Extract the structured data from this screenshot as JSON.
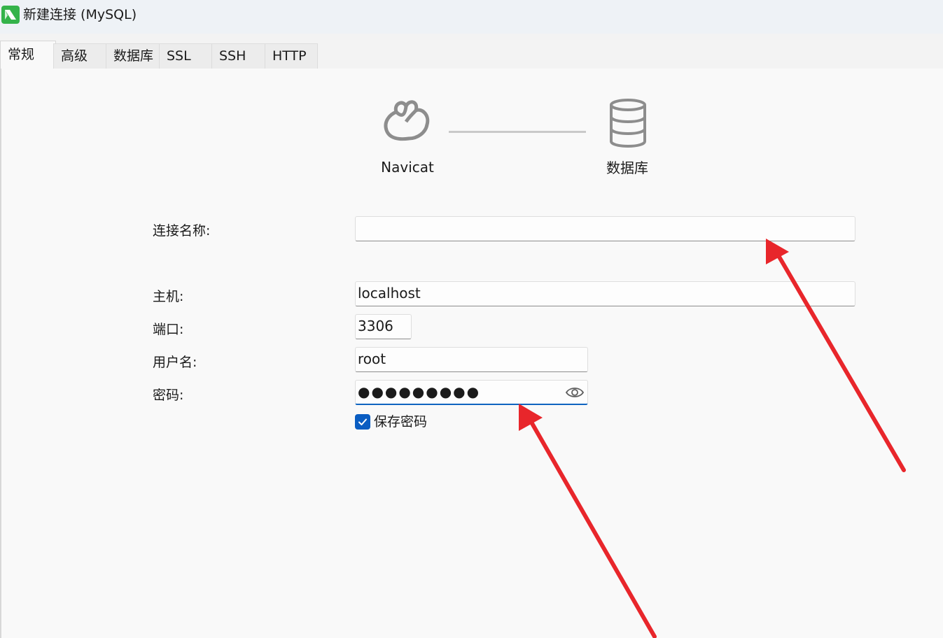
{
  "window": {
    "title": "新建连接 (MySQL)",
    "icon": "navicat-app-icon"
  },
  "tabs": [
    {
      "label": "常规",
      "active": true
    },
    {
      "label": "高级",
      "active": false
    },
    {
      "label": "数据库",
      "active": false
    },
    {
      "label": "SSL",
      "active": false
    },
    {
      "label": "SSH",
      "active": false
    },
    {
      "label": "HTTP",
      "active": false
    }
  ],
  "header": {
    "left_label": "Navicat",
    "right_label": "数据库",
    "left_icon": "navicat-logo-icon",
    "right_icon": "database-icon"
  },
  "form": {
    "connection_name": {
      "label": "连接名称:",
      "value": ""
    },
    "host": {
      "label": "主机:",
      "value": "localhost"
    },
    "port": {
      "label": "端口:",
      "value": "3306"
    },
    "username": {
      "label": "用户名:",
      "value": "root"
    },
    "password": {
      "label": "密码:",
      "masked_value": "●●●●●●●●●"
    },
    "save_password": {
      "label": "保存密码",
      "checked": true
    }
  },
  "colors": {
    "accent": "#0a5dc2",
    "annotation_arrow": "#e8262b"
  }
}
